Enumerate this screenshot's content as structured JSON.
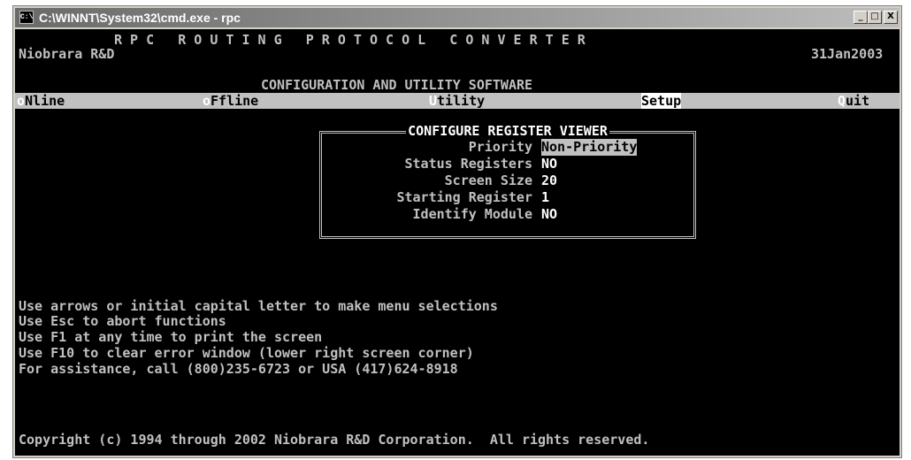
{
  "window": {
    "title": "C:\\WINNT\\System32\\cmd.exe - rpc",
    "minimize": "_",
    "maximize": "□",
    "close": "X",
    "icon_text": "C:\\"
  },
  "header": {
    "title_line": "R P C   R O U T I N G   P R O T O C O L   C O N V E R T E R",
    "company": "Niobrara R&D",
    "date": "31Jan2003",
    "subtitle": "CONFIGURATION AND UTILITY SOFTWARE"
  },
  "menu": {
    "online": {
      "hot": "o",
      "rest": "Nline"
    },
    "offline": {
      "hot": "o",
      "rest": "Ffline"
    },
    "utility": {
      "hot": "U",
      "rest": "tility"
    },
    "setup": {
      "label": "Setup"
    },
    "quit": {
      "hot": "Q",
      "rest": "uit"
    }
  },
  "dialog": {
    "title": "CONFIGURE REGISTER VIEWER",
    "fields": [
      {
        "label": "Priority",
        "value": "Non-Priority"
      },
      {
        "label": "Status Registers",
        "value": "NO"
      },
      {
        "label": "Screen Size",
        "value": "20"
      },
      {
        "label": "Starting Register",
        "value": "1"
      },
      {
        "label": "Identify Module",
        "value": "NO"
      }
    ]
  },
  "help_lines": [
    "Use arrows or initial capital letter to make menu selections",
    "Use Esc to abort functions",
    "Use F1 at any time to print the screen",
    "Use F10 to clear error window (lower right screen corner)",
    "For assistance, call (800)235-6723 or USA (417)624-8918"
  ],
  "copyright": "Copyright (c) 1994 through 2002 Niobrara R&D Corporation.  All rights reserved."
}
